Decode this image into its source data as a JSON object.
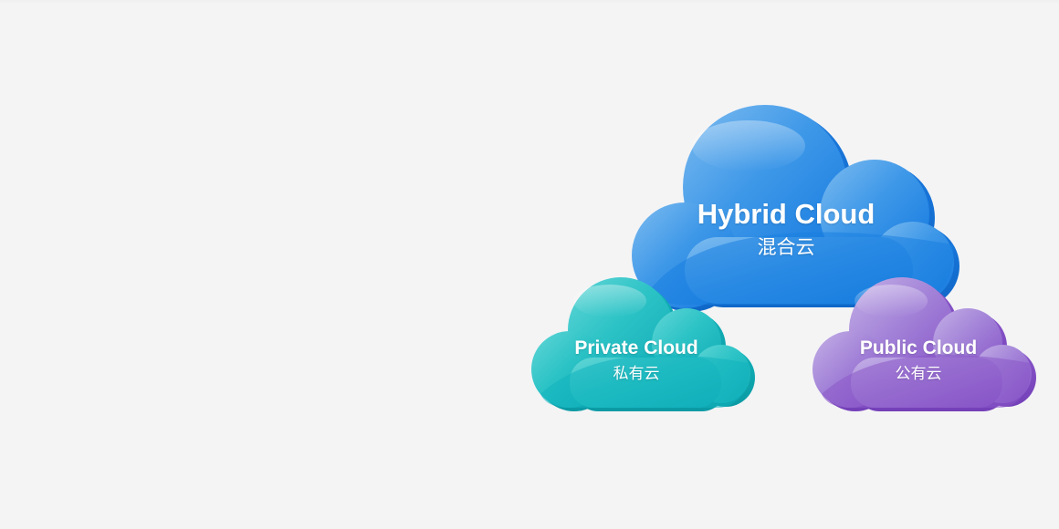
{
  "clouds": {
    "hybrid": {
      "label_en": "Hybrid Cloud",
      "label_zh": "混合云",
      "color_light": "#69b3ee",
      "color_dark": "#1a7fe0"
    },
    "private": {
      "label_en": "Private Cloud",
      "label_zh": "私有云",
      "color_light": "#4fd0d0",
      "color_dark": "#10b3bd"
    },
    "public": {
      "label_en": "Public Cloud",
      "label_zh": "公有云",
      "color_light": "#b7a2e0",
      "color_dark": "#8a57c9"
    }
  },
  "background_color": "#f4f4f5"
}
